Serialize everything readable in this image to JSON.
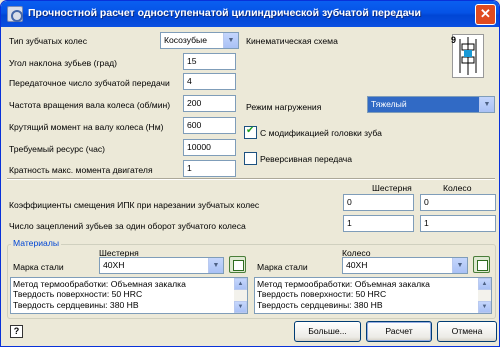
{
  "window": {
    "title": "Прочностной расчет одноступенчатой цилиндрической зубчатой передачи",
    "close": "✕"
  },
  "params": {
    "gear_type": {
      "label": "Тип зубчатых колес",
      "value": "Косозубые"
    },
    "helix_angle": {
      "label": "Угол наклона зубьев (град)",
      "value": "15"
    },
    "gear_ratio": {
      "label": "Передаточное число зубчатой передачи",
      "value": "4"
    },
    "speed": {
      "label": "Частота вращения вала колеса (об/мин)",
      "value": "200"
    },
    "torque": {
      "label": "Крутящий момент на валу колеса (Нм)",
      "value": "600"
    },
    "life": {
      "label": "Требуемый ресурс (час)",
      "value": "10000"
    },
    "max_torque_ratio": {
      "label": "Кратность макс. момента двигателя",
      "value": "1"
    }
  },
  "scheme": {
    "label": "Кинематическая схема",
    "number": "9"
  },
  "load_mode": {
    "label": "Режим нагружения",
    "value": "Тяжелый"
  },
  "options": {
    "tip_modification": {
      "label": "С модификацией головки зуба",
      "checked": true
    },
    "reversible": {
      "label": "Реверсивная передача",
      "checked": false
    }
  },
  "shift": {
    "pinion_header": "Шестерня",
    "wheel_header": "Колесо",
    "coef_label": "Коэффициенты смещения ИПК при нарезании зубчатых колес",
    "coef_pinion": "0",
    "coef_wheel": "0",
    "mesh_label": "Число зацеплений зубьев за один оборот зубчатого колеса",
    "mesh_pinion": "1",
    "mesh_wheel": "1"
  },
  "materials": {
    "title": "Материалы",
    "pinion": {
      "header": "Шестерня",
      "steel_label": "Марка стали",
      "steel": "40ХН",
      "lines": [
        "Метод термообработки: Объемная закалка",
        "Твердость поверхности: 50 HRC",
        "Твердость сердцевины: 380 HB"
      ]
    },
    "wheel": {
      "header": "Колесо",
      "steel_label": "Марка стали",
      "steel": "40ХН",
      "lines": [
        "Метод термообработки: Объемная закалка",
        "Твердость поверхности: 50 HRC",
        "Твердость сердцевины: 380 HB"
      ]
    }
  },
  "buttons": {
    "help": "?",
    "more": "Больше...",
    "calc": "Расчет",
    "cancel": "Отмена"
  }
}
